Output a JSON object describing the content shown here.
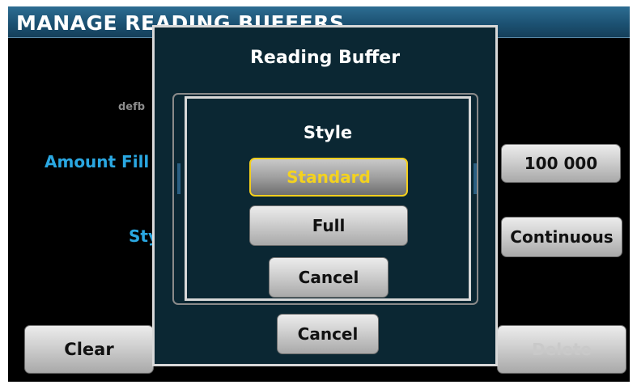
{
  "header": {
    "title": "MANAGE READING BUFFERS"
  },
  "background": {
    "buffer_name_partial": "defb",
    "amount_filled_label": "Amount Fill",
    "style_label": "Sty",
    "capacity_value": "100 000",
    "style_value": "Continuous",
    "clear_label": "Clear",
    "delete_label": "Delete"
  },
  "dialog": {
    "title": "Reading Buffer",
    "cancel_label": "Cancel"
  },
  "style_dialog": {
    "title": "Style",
    "options": [
      "Standard",
      "Full"
    ],
    "selected": "Standard",
    "cancel_label": "Cancel"
  },
  "colors": {
    "accent_label": "#2aa7e1",
    "selection": "#f3cf1d",
    "dialog_bg": "#0b2733",
    "titlebar": "#1c5273"
  }
}
